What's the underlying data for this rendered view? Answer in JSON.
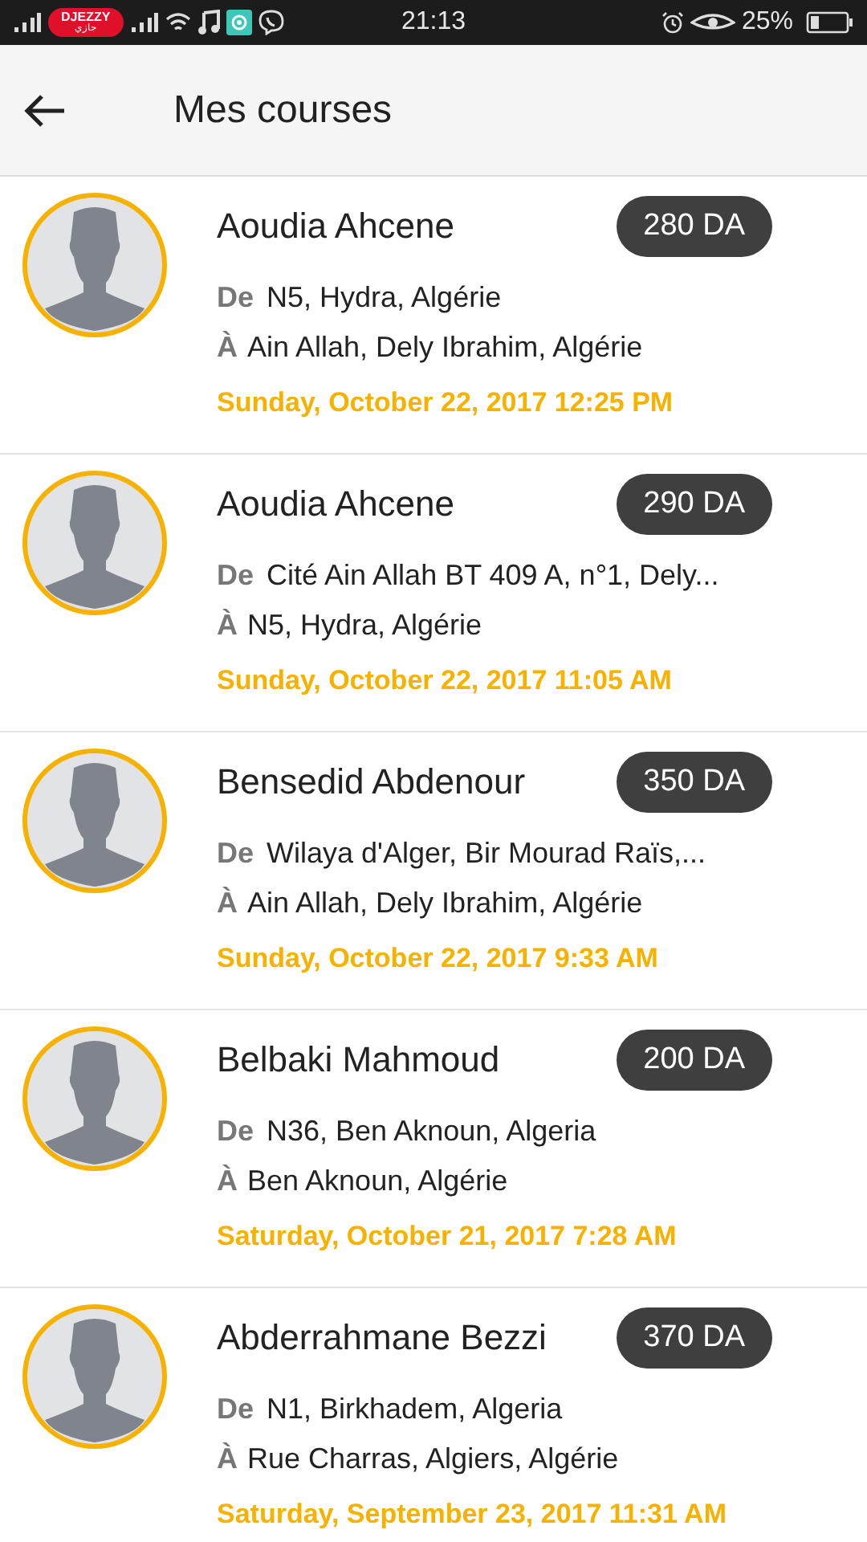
{
  "status_bar": {
    "carrier": "DJEZZY",
    "carrier_sub": "جازي",
    "time": "21:13",
    "battery": "25%"
  },
  "header": {
    "title": "Mes courses"
  },
  "rides": [
    {
      "name": "Aoudia Ahcene",
      "price": "280 DA",
      "from_label": "De",
      "from": "N5, Hydra, Algérie",
      "to_label": "À",
      "to": "Ain Allah, Dely Ibrahim, Algérie",
      "date": "Sunday, October 22, 2017 12:25 PM"
    },
    {
      "name": "Aoudia Ahcene",
      "price": "290 DA",
      "from_label": "De",
      "from": "Cité Ain Allah BT 409 A, n°1, Dely...",
      "to_label": "À",
      "to": "N5, Hydra, Algérie",
      "date": "Sunday, October 22, 2017 11:05 AM"
    },
    {
      "name": "Bensedid Abdenour",
      "price": "350 DA",
      "from_label": "De",
      "from": "Wilaya d'Alger, Bir Mourad Raïs,...",
      "to_label": "À",
      "to": "Ain Allah, Dely Ibrahim, Algérie",
      "date": "Sunday, October 22, 2017 9:33 AM"
    },
    {
      "name": "Belbaki Mahmoud",
      "price": "200 DA",
      "from_label": "De",
      "from": "N36, Ben Aknoun, Algeria",
      "to_label": "À",
      "to": "Ben Aknoun, Algérie",
      "date": "Saturday, October 21, 2017 7:28 AM"
    },
    {
      "name": "Abderrahmane Bezzi",
      "price": "370 DA",
      "from_label": "De",
      "from": "N1, Birkhadem, Algeria",
      "to_label": "À",
      "to": "Rue Charras, Algiers, Algérie",
      "date": "Saturday, September 23, 2017 11:31 AM"
    }
  ]
}
